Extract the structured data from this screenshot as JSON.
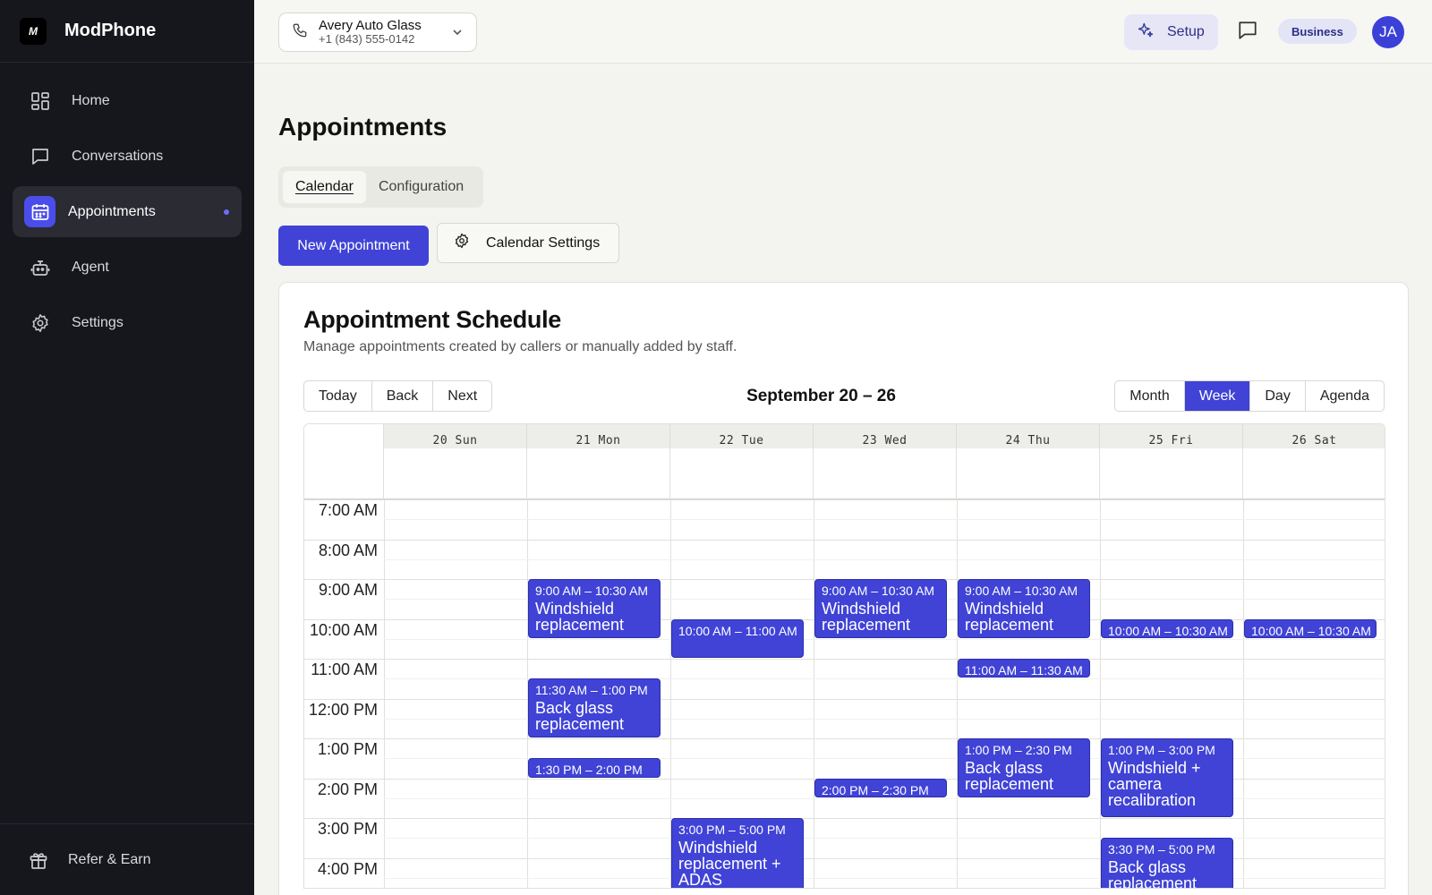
{
  "app": {
    "name": "ModPhone",
    "logo_text": "M"
  },
  "sidebar": {
    "items": [
      {
        "label": "Home",
        "icon": "grid-icon"
      },
      {
        "label": "Conversations",
        "icon": "chat-bubble-icon"
      },
      {
        "label": "Appointments",
        "icon": "calendar-icon",
        "active": true
      },
      {
        "label": "Agent",
        "icon": "robot-icon"
      },
      {
        "label": "Settings",
        "icon": "gear-icon"
      }
    ],
    "footer": {
      "label": "Refer & Earn",
      "icon": "gift-icon"
    }
  },
  "topbar": {
    "business_name": "Avery Auto Glass",
    "phone_number": "+1 (843) 555-0142",
    "setup_label": "Setup",
    "plan_badge": "Business",
    "avatar_initials": "JA"
  },
  "page": {
    "title": "Appointments",
    "tabs": [
      {
        "label": "Calendar",
        "active": true
      },
      {
        "label": "Configuration",
        "active": false
      }
    ],
    "new_appointment_label": "New Appointment",
    "calendar_settings_label": "Calendar Settings"
  },
  "schedule": {
    "title": "Appointment Schedule",
    "subtitle": "Manage appointments created by callers or manually added by staff.",
    "nav_buttons": [
      "Today",
      "Back",
      "Next"
    ],
    "range_label": "September 20 – 26",
    "views": [
      {
        "label": "Month",
        "selected": false
      },
      {
        "label": "Week",
        "selected": true
      },
      {
        "label": "Day",
        "selected": false
      },
      {
        "label": "Agenda",
        "selected": false
      }
    ],
    "days": [
      "20 Sun",
      "21 Mon",
      "22 Tue",
      "23 Wed",
      "24 Thu",
      "25 Fri",
      "26 Sat"
    ],
    "hours": [
      "7:00 AM",
      "8:00 AM",
      "9:00 AM",
      "10:00 AM",
      "11:00 AM",
      "12:00 PM",
      "1:00 PM",
      "2:00 PM",
      "3:00 PM",
      "4:00 PM"
    ],
    "first_hour": 7,
    "events": [
      {
        "day": 1,
        "start": 9.0,
        "end": 10.5,
        "time": "9:00 AM – 10:30 AM",
        "title": "Windshield replacement"
      },
      {
        "day": 1,
        "start": 11.5,
        "end": 13.0,
        "time": "11:30 AM – 1:00 PM",
        "title": "Back glass replacement"
      },
      {
        "day": 1,
        "start": 13.5,
        "end": 14.0,
        "time": "1:30 PM – 2:00 PM",
        "title": ""
      },
      {
        "day": 2,
        "start": 10.0,
        "end": 11.0,
        "time": "10:00 AM – 11:00 AM",
        "title": ""
      },
      {
        "day": 2,
        "start": 15.0,
        "end": 17.0,
        "time": "3:00 PM – 5:00 PM",
        "title": "Windshield replacement + ADAS"
      },
      {
        "day": 3,
        "start": 9.0,
        "end": 10.5,
        "time": "9:00 AM – 10:30 AM",
        "title": "Windshield replacement"
      },
      {
        "day": 3,
        "start": 14.0,
        "end": 14.5,
        "time": "2:00 PM – 2:30 PM",
        "title": ""
      },
      {
        "day": 4,
        "start": 9.0,
        "end": 10.5,
        "time": "9:00 AM – 10:30 AM",
        "title": "Windshield replacement"
      },
      {
        "day": 4,
        "start": 11.0,
        "end": 11.5,
        "time": "11:00 AM – 11:30 AM",
        "title": ""
      },
      {
        "day": 4,
        "start": 13.0,
        "end": 14.5,
        "time": "1:00 PM – 2:30 PM",
        "title": "Back glass replacement"
      },
      {
        "day": 5,
        "start": 10.0,
        "end": 10.5,
        "time": "10:00 AM – 10:30 AM",
        "title": ""
      },
      {
        "day": 5,
        "start": 13.0,
        "end": 15.0,
        "time": "1:00 PM – 3:00 PM",
        "title": "Windshield + camera recalibration"
      },
      {
        "day": 5,
        "start": 15.5,
        "end": 17.0,
        "time": "3:30 PM – 5:00 PM",
        "title": "Back glass replacement"
      },
      {
        "day": 6,
        "start": 10.0,
        "end": 10.5,
        "time": "10:00 AM – 10:30 AM",
        "title": ""
      }
    ]
  },
  "colors": {
    "accent": "#4043d6",
    "sidebar_bg": "#16171c",
    "page_bg": "#f3f3ef"
  }
}
